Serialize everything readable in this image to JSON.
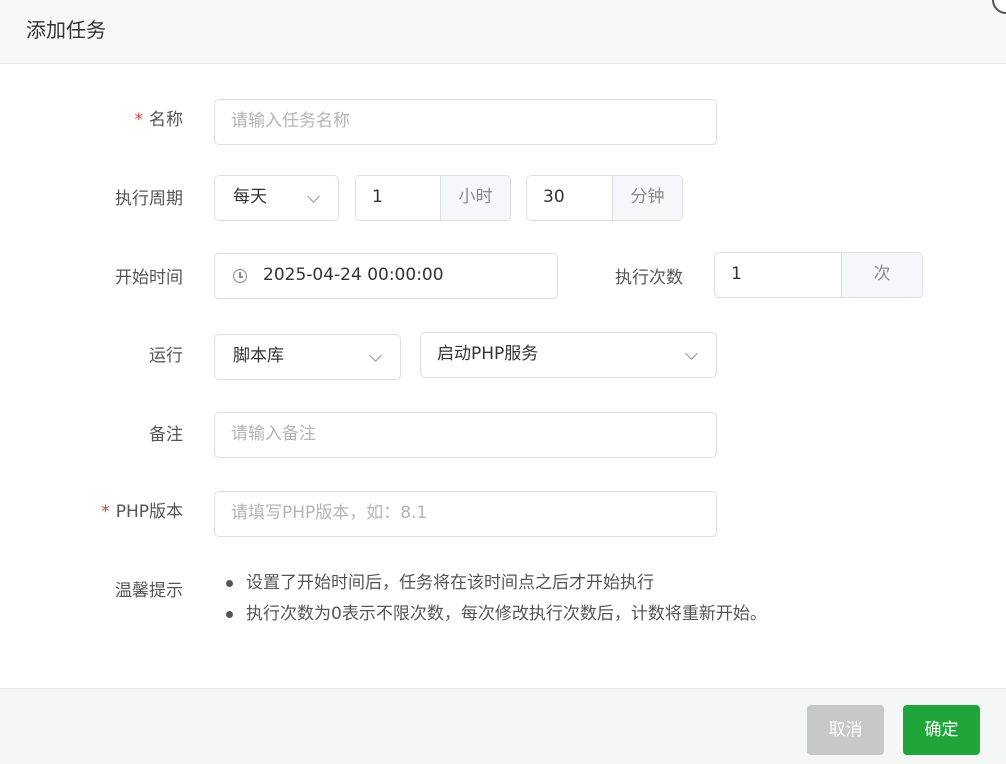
{
  "dialog": {
    "title": "添加任务"
  },
  "form": {
    "name": {
      "label": "名称",
      "required_mark": "*",
      "placeholder": "请输入任务名称"
    },
    "period": {
      "label": "执行周期",
      "frequency": "每天",
      "hours_value": "1",
      "hours_unit": "小时",
      "minutes_value": "30",
      "minutes_unit": "分钟"
    },
    "start_time": {
      "label": "开始时间",
      "value": "2025-04-24 00:00:00"
    },
    "exec_count": {
      "label": "执行次数",
      "value": "1",
      "unit": "次"
    },
    "run": {
      "label": "运行",
      "type": "脚本库",
      "script": "启动PHP服务"
    },
    "remark": {
      "label": "备注",
      "placeholder": "请输入备注"
    },
    "php_version": {
      "label": "PHP版本",
      "required_mark": "*",
      "placeholder": "请填写PHP版本，如：8.1"
    },
    "tips": {
      "label": "温馨提示",
      "items": [
        "设置了开始时间后，任务将在该时间点之后才开始执行",
        "执行次数为0表示不限次数，每次修改执行次数后，计数将重新开始。"
      ]
    }
  },
  "footer": {
    "cancel": "取消",
    "confirm": "确定"
  },
  "colors": {
    "primary": "#20a53a",
    "cancel": "#c8c8c8",
    "required": "#e23c3c"
  }
}
